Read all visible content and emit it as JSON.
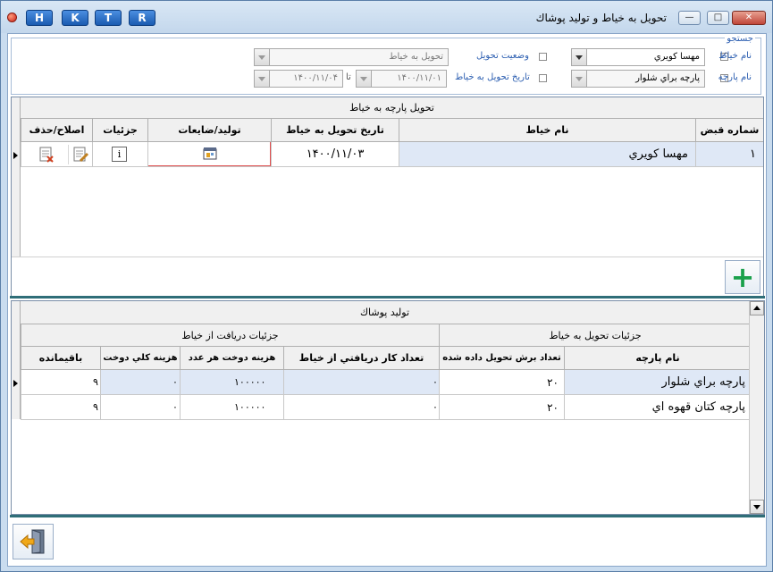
{
  "window": {
    "title": "تحويل به خياط و توليد پوشاك",
    "hotkeys": [
      "H",
      "K",
      "T",
      "R"
    ],
    "controls": {
      "minimize": "—",
      "maximize": "□",
      "close": "✕"
    }
  },
  "search": {
    "legend": "جستجو",
    "tailor_name": {
      "label": "نام خياط",
      "checked": true,
      "value": "مهسا كويري"
    },
    "delivery_status": {
      "label": "وضعيت تحويل",
      "checked": false,
      "value": "تحويل به خياط"
    },
    "fabric_name": {
      "label": "نام پارچه",
      "checked": false,
      "value": "پارچه براي شلوار"
    },
    "delivery_date": {
      "label": "تاريخ تحويل به خياط",
      "checked": false,
      "from": "۱۴۰۰/۱۱/۰۱",
      "to_label": "تا",
      "to": "۱۴۰۰/۱۱/۰۴"
    }
  },
  "delivery_grid": {
    "caption": "تحويل پارچه به خياط",
    "columns": {
      "receipt_no": "شماره قبض",
      "tailor_name": "نام خياط",
      "date": "تاريخ تحويل به خياط",
      "production": "توليد/ضايعات",
      "details": "جزئيات",
      "edit_delete": "اصلاح/حذف"
    },
    "rows": [
      {
        "receipt_no": "۱",
        "tailor_name": "مهسا كويري",
        "date": "۱۴۰۰/۱۱/۰۳"
      }
    ],
    "add_label": "+"
  },
  "production_grid": {
    "caption": "توليد پوشاك",
    "group_delivery": "جزئيات تحويل به خياط",
    "group_received": "جزئيات دريافت از خياط",
    "columns": {
      "fabric_name": "نام پارچه",
      "cut_count": "تعداد برش تحويل داده شده",
      "received_count": "تعداد كار دريافتي از خياط",
      "unit_cost": "هزينه دوخت هر عدد",
      "total_cost": "هزينه كلي دوخت",
      "remaining": "باقيمانده"
    },
    "rows": [
      {
        "fabric_name": "پارچه براي شلوار",
        "cut_count": "۲۰",
        "received_count": "۰",
        "unit_cost": "۱۰۰۰۰۰",
        "total_cost": "۰",
        "remaining": "۹"
      },
      {
        "fabric_name": "پارچه كتان قهوه اي",
        "cut_count": "۲۰",
        "received_count": "۰",
        "unit_cost": "۱۰۰۰۰۰",
        "total_cost": "۰",
        "remaining": "۹"
      }
    ]
  },
  "colors": {
    "accent": "#2a5db0",
    "divider": "#2f6e78",
    "highlight": "#e05050",
    "add": "#1aa04a"
  }
}
